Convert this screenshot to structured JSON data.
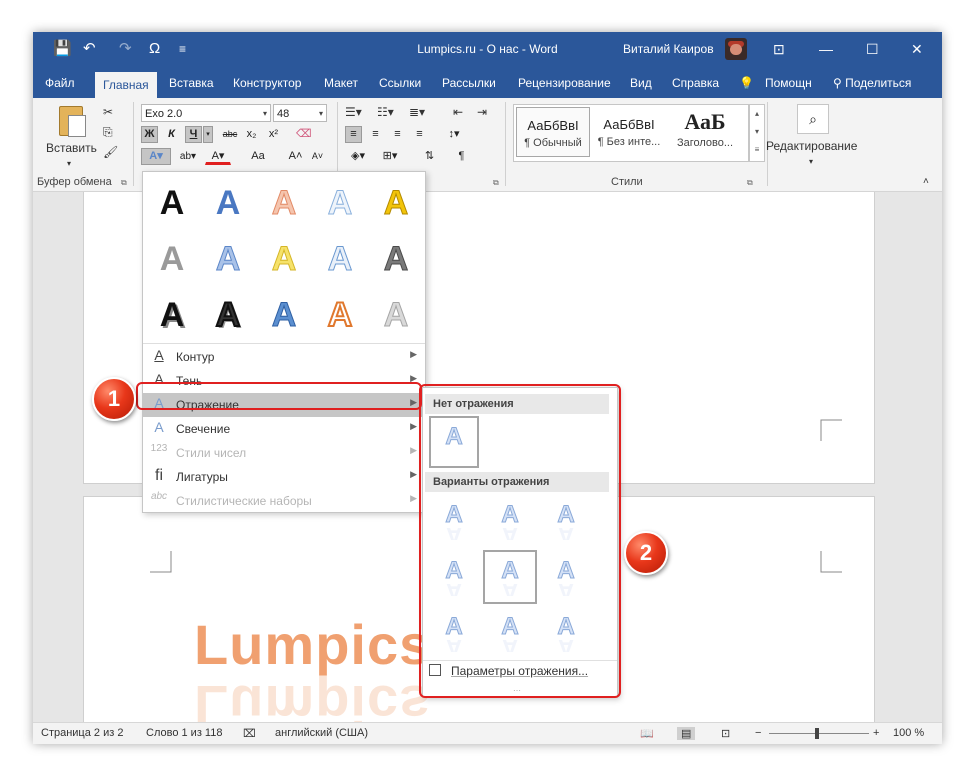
{
  "window": {
    "title": "Lumpics.ru - О нас  -  Word",
    "user_name": "Виталий Каиров",
    "controls": {
      "ribbon_display": "⊡",
      "minimize": "—",
      "maximize": "☐",
      "close": "✕"
    }
  },
  "qat": {
    "save": "💾",
    "undo": "↶",
    "redo": "↷",
    "omega": "Ω",
    "more": "≡"
  },
  "tabs": [
    "Файл",
    "Главная",
    "Вставка",
    "Конструктор",
    "Макет",
    "Ссылки",
    "Рассылки",
    "Рецензирование",
    "Вид",
    "Справка",
    "Помощн",
    "Поделиться"
  ],
  "ribbon": {
    "clipboard": {
      "paste_label": "Вставить",
      "group_label": "Буфер обмена"
    },
    "font": {
      "font_name": "Exo 2.0",
      "font_size": "48",
      "bold": "Ж",
      "italic": "К",
      "underline": "Ч",
      "strike": "abc",
      "sub": "x₂",
      "sup": "x²",
      "case": "Aa",
      "grow": "A˄",
      "shrink": "A˅"
    },
    "styles": {
      "group_label": "Стили",
      "items": [
        {
          "sample": "АаБбВвI",
          "name": "¶ Обычный"
        },
        {
          "sample": "АаБбВвI",
          "name": "¶ Без инте..."
        },
        {
          "sample": "АаБ",
          "name": "Заголово..."
        }
      ]
    },
    "editing": {
      "label": "Редактирование"
    },
    "font_group_marker": "Ш"
  },
  "effects_menu": {
    "items": [
      {
        "icon": "A",
        "label": "Контур",
        "disabled": false
      },
      {
        "icon": "A",
        "label": "Тень",
        "disabled": false
      },
      {
        "icon": "A",
        "label": "Отражение",
        "disabled": false
      },
      {
        "icon": "A",
        "label": "Свечение",
        "disabled": false
      },
      {
        "icon": "123",
        "label": "Стили чисел",
        "disabled": true
      },
      {
        "icon": "fi",
        "label": "Лигатуры",
        "disabled": false
      },
      {
        "icon": "abc",
        "label": "Стилистические наборы",
        "disabled": true
      }
    ]
  },
  "reflection_menu": {
    "no_reflection_header": "Нет отражения",
    "variants_header": "Варианты отражения",
    "options_label": "Параметры отражения...",
    "glyph": "A"
  },
  "document": {
    "word_art_text": "Lumpics"
  },
  "status": {
    "page": "Страница 2 из 2",
    "words": "Слово 1 из 118",
    "language": "английский (США)",
    "zoom": "100 %"
  },
  "callouts": [
    "1",
    "2"
  ],
  "colors": {
    "brand": "#2b579a",
    "callout": "#e02020",
    "wordart": "#f0a070"
  }
}
